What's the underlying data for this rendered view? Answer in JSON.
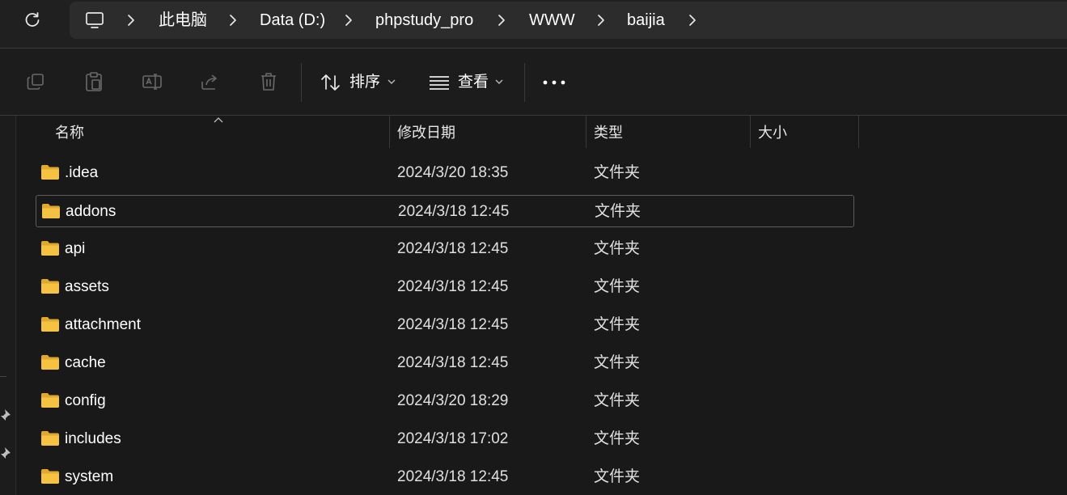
{
  "breadcrumb": {
    "items": [
      "此电脑",
      "Data (D:)",
      "phpstudy_pro",
      "WWW",
      "baijia"
    ]
  },
  "toolbar": {
    "sort_label": "排序",
    "view_label": "查看"
  },
  "columns": {
    "name": "名称",
    "modified": "修改日期",
    "type": "类型",
    "size": "大小"
  },
  "files": [
    {
      "name": ".idea",
      "modified": "2024/3/20 18:35",
      "type": "文件夹",
      "size": ""
    },
    {
      "name": "addons",
      "modified": "2024/3/18 12:45",
      "type": "文件夹",
      "size": ""
    },
    {
      "name": "api",
      "modified": "2024/3/18 12:45",
      "type": "文件夹",
      "size": ""
    },
    {
      "name": "assets",
      "modified": "2024/3/18 12:45",
      "type": "文件夹",
      "size": ""
    },
    {
      "name": "attachment",
      "modified": "2024/3/18 12:45",
      "type": "文件夹",
      "size": ""
    },
    {
      "name": "cache",
      "modified": "2024/3/18 12:45",
      "type": "文件夹",
      "size": ""
    },
    {
      "name": "config",
      "modified": "2024/3/20 18:29",
      "type": "文件夹",
      "size": ""
    },
    {
      "name": "includes",
      "modified": "2024/3/18 17:02",
      "type": "文件夹",
      "size": ""
    },
    {
      "name": "system",
      "modified": "2024/3/18 12:45",
      "type": "文件夹",
      "size": ""
    }
  ],
  "colors": {
    "background": "#191919",
    "folder": "#f5c341",
    "folder_dark": "#e0a82e",
    "selection_border": "#5c5c5c"
  }
}
